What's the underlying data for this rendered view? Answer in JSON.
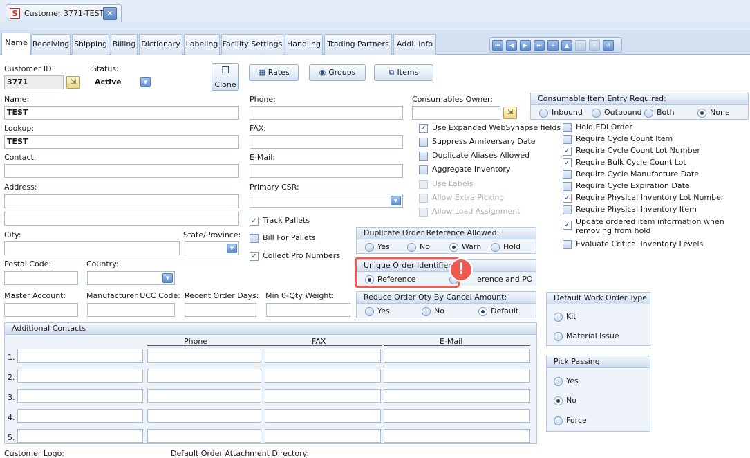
{
  "doc_tab": {
    "logo_letter": "S",
    "title": "Customer 3771-TEST",
    "close": "✕"
  },
  "tabs": [
    "Name",
    "Receiving",
    "Shipping",
    "Billing",
    "Dictionary",
    "Labeling",
    "Facility Settings",
    "Handling",
    "Trading Partners",
    "Addl. Info"
  ],
  "nav_buttons": [
    "⏮",
    "◀",
    "▶",
    "⏭",
    "+",
    "▲",
    "✓",
    "✕",
    "↺"
  ],
  "customer_id": {
    "label": "Customer ID:",
    "value": "3771"
  },
  "status": {
    "label": "Status:",
    "value": "Active"
  },
  "buttons": {
    "clone": "Clone",
    "rates": "Rates",
    "groups": "Groups",
    "items": "Items"
  },
  "name": {
    "label": "Name:",
    "value": "TEST"
  },
  "lookup": {
    "label": "Lookup:",
    "value": "TEST"
  },
  "contact": {
    "label": "Contact:",
    "value": ""
  },
  "address": {
    "label": "Address:",
    "value1": "",
    "value2": ""
  },
  "city": {
    "label": "City:",
    "value": ""
  },
  "state": {
    "label": "State/Province:",
    "value": ""
  },
  "postal": {
    "label": "Postal Code:",
    "value": ""
  },
  "country": {
    "label": "Country:",
    "value": ""
  },
  "master_account": {
    "label": "Master Account:",
    "value": ""
  },
  "manufacturer_ucc": {
    "label": "Manufacturer UCC Code:",
    "value": ""
  },
  "recent_order_days": {
    "label": "Recent Order Days:",
    "value": ""
  },
  "min_qty_weight": {
    "label": "Min 0-Qty Weight:",
    "value": ""
  },
  "phone": {
    "label": "Phone:",
    "value": ""
  },
  "fax": {
    "label": "FAX:",
    "value": ""
  },
  "email": {
    "label": "E-Mail:",
    "value": ""
  },
  "primary_csr": {
    "label": "Primary CSR:",
    "value": ""
  },
  "pallet_checks": [
    {
      "label": "Track Pallets",
      "checked": true
    },
    {
      "label": "Bill For Pallets",
      "checked": false
    },
    {
      "label": "Collect Pro Numbers",
      "checked": true
    }
  ],
  "consumables_owner": {
    "label": "Consumables Owner:",
    "value": ""
  },
  "mid_checks": [
    {
      "label": "Use Expanded WebSynapse fields",
      "checked": true,
      "disabled": false
    },
    {
      "label": "Suppress Anniversary Date",
      "checked": false,
      "disabled": false
    },
    {
      "label": "Duplicate Aliases Allowed",
      "checked": false,
      "disabled": false
    },
    {
      "label": "Aggregate Inventory",
      "checked": false,
      "disabled": false
    },
    {
      "label": "Use Labels",
      "checked": false,
      "disabled": true
    },
    {
      "label": "Allow Extra Picking",
      "checked": false,
      "disabled": true
    },
    {
      "label": "Allow Load Assignment",
      "checked": false,
      "disabled": true
    }
  ],
  "consumable_entry": {
    "title": "Consumable Item Entry Required:",
    "options": [
      "Inbound",
      "Outbound",
      "Both",
      "None"
    ],
    "selected": "None"
  },
  "right_checks": [
    {
      "label": "Hold EDI Order",
      "checked": false
    },
    {
      "label": "Require Cycle Count Item",
      "checked": false
    },
    {
      "label": "Require Cycle Count Lot Number",
      "checked": true
    },
    {
      "label": "Require Bulk Cycle Count Lot",
      "checked": true
    },
    {
      "label": "Require Cycle Manufacture Date",
      "checked": false
    },
    {
      "label": "Require Cycle Expiration Date",
      "checked": false
    },
    {
      "label": "Require Physical Inventory Lot Number",
      "checked": true
    },
    {
      "label": "Require Physical Inventory Item",
      "checked": false
    },
    {
      "label": "Update ordered item information when removing from hold",
      "checked": true
    },
    {
      "label": "Evaluate Critical Inventory Levels",
      "checked": false
    }
  ],
  "dup_order_ref": {
    "title": "Duplicate Order Reference Allowed:",
    "options": [
      "Yes",
      "No",
      "Warn",
      "Hold"
    ],
    "selected": "Warn"
  },
  "unique_order_id": {
    "title": "Unique Order Identifier",
    "options": [
      "Reference",
      "Reference and PO"
    ],
    "selected": "Reference",
    "po_visible_text": "erence and PO"
  },
  "reduce_order_qty": {
    "title": "Reduce Order Qty By Cancel Amount:",
    "options": [
      "Yes",
      "No",
      "Default"
    ],
    "selected": "Default"
  },
  "default_work_order": {
    "title": "Default Work Order Type",
    "options": [
      "Kit",
      "Material Issue"
    ],
    "selected": ""
  },
  "pick_passing": {
    "title": "Pick Passing",
    "options": [
      "Yes",
      "No",
      "Force"
    ],
    "selected": "No"
  },
  "additional_contacts": {
    "title": "Additional Contacts",
    "columns": [
      "Phone",
      "FAX",
      "E-Mail"
    ],
    "rows": [
      "1.",
      "2.",
      "3.",
      "4.",
      "5."
    ]
  },
  "footer": {
    "customer_logo": "Customer Logo:",
    "attachment_dir": "Default Order Attachment Directory:"
  },
  "alert_glyph": "!",
  "colors": {
    "accent": "#5f8fcf",
    "callout": "#ef5a50",
    "panel": "#ffffff",
    "background": "#e3ecf7"
  }
}
